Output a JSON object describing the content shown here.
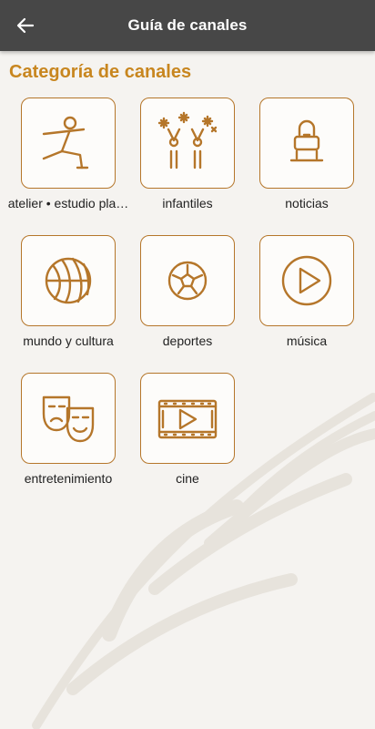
{
  "appbar": {
    "title": "Guía de canales",
    "back_icon": "arrow-left-icon"
  },
  "section": {
    "title": "Categoría de canales"
  },
  "colors": {
    "accent": "#c8861f",
    "icon": "#b5762a",
    "appbar": "#474747"
  },
  "categories": [
    {
      "label": "atelier • estudio pla…",
      "icon": "yoga-pose-icon"
    },
    {
      "label": "infantiles",
      "icon": "kids-celebration-icon"
    },
    {
      "label": "noticias",
      "icon": "news-anchor-icon"
    },
    {
      "label": "mundo y cultura",
      "icon": "globe-icon"
    },
    {
      "label": "deportes",
      "icon": "soccer-ball-icon"
    },
    {
      "label": "música",
      "icon": "play-circle-icon"
    },
    {
      "label": "entretenimiento",
      "icon": "theater-masks-icon"
    },
    {
      "label": "cine",
      "icon": "film-strip-icon"
    }
  ]
}
